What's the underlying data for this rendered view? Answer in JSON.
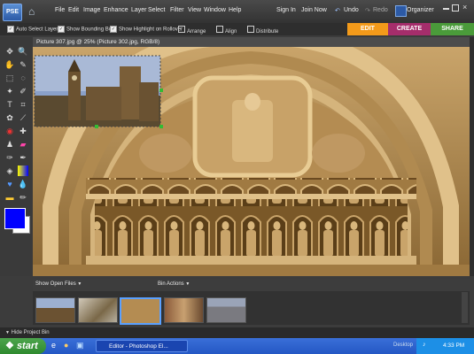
{
  "menubar": {
    "app_logo": "PSE",
    "items": [
      "File",
      "Edit",
      "Image",
      "Enhance",
      "Layer",
      "Select",
      "Filter",
      "View",
      "Window",
      "Help"
    ],
    "sign_in": "Sign In",
    "join_now": "Join Now",
    "undo": "Undo",
    "redo": "Redo",
    "organizer": "Organizer"
  },
  "mode_tabs": {
    "edit": "EDIT",
    "create": "CREATE",
    "share": "SHARE",
    "colors": {
      "edit": "#f39a1a",
      "create": "#c2185b",
      "share": "#4a9b3a"
    }
  },
  "options_bar": {
    "auto_select": "Auto Select Layer",
    "bounding_box": "Show Bounding Box",
    "highlight": "Show Highlight on Rollover",
    "arrange": "Arrange",
    "align": "Align",
    "distribute": "Distribute"
  },
  "document": {
    "title": "Picture 307.jpg @ 25% (Picture 302.jpg, RGB/8)"
  },
  "tools": {
    "foreground": "#0000ff",
    "background": "#ffffff"
  },
  "bin": {
    "show_open_files": "Show Open Files",
    "bin_actions": "Bin Actions",
    "hide_label": "Hide Project Bin"
  },
  "taskbar": {
    "start": "start",
    "editor_task": "Editor - Photoshop El...",
    "desktop": "Desktop",
    "clock": "4:33 PM"
  }
}
